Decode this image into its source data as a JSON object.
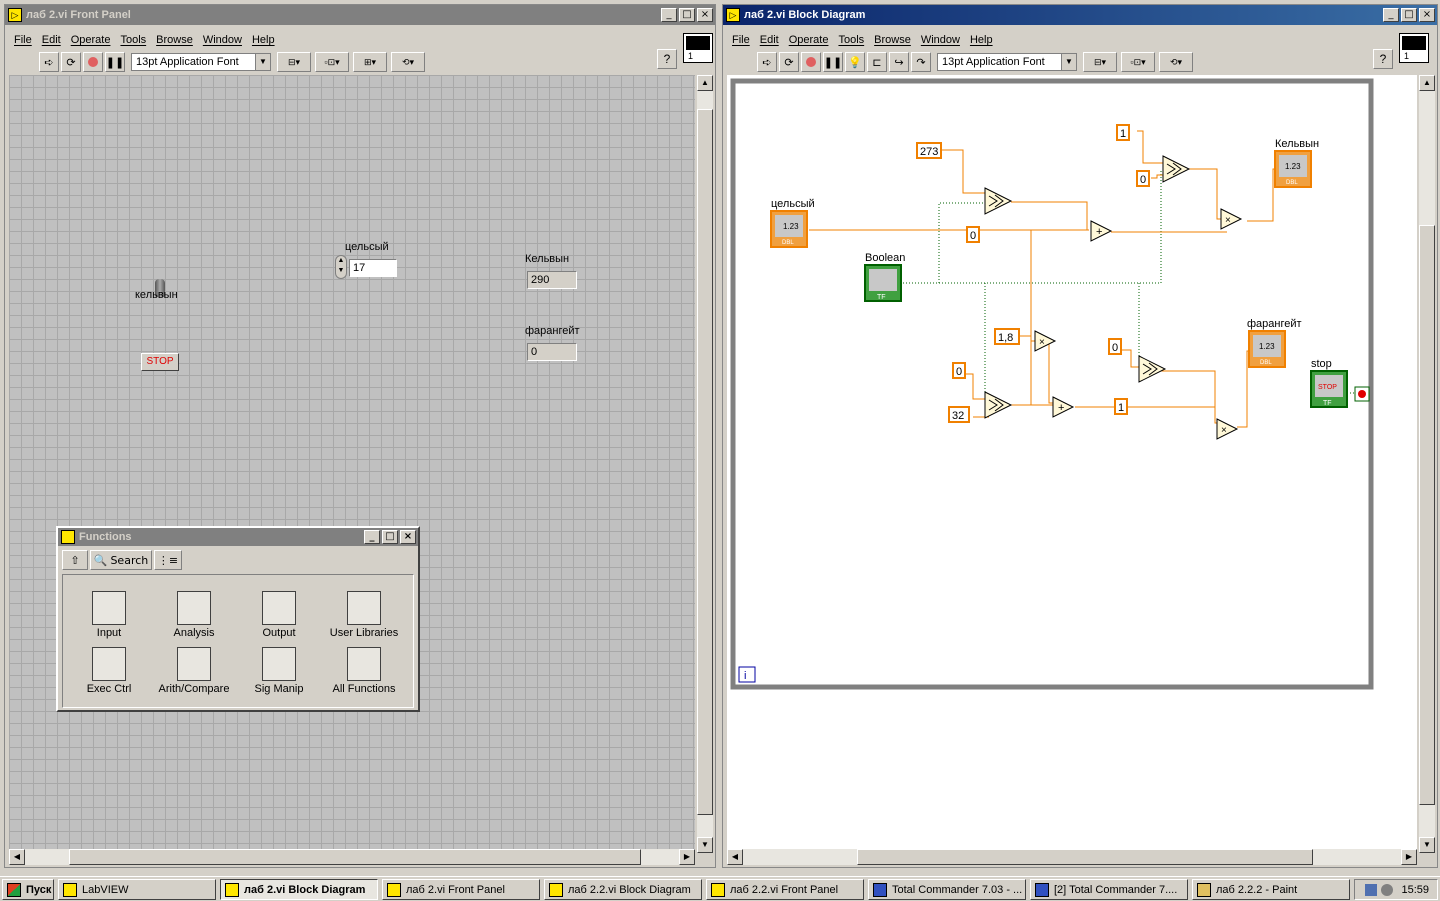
{
  "front_panel": {
    "title": "лаб 2.vi Front Panel",
    "menu": [
      "File",
      "Edit",
      "Operate",
      "Tools",
      "Browse",
      "Window",
      "Help"
    ],
    "font": "13pt Application Font",
    "vi_number": "1",
    "controls": {
      "toggle_label": "кельвын",
      "celsius_label": "цельсый",
      "celsius_value": "17",
      "kelvin_label": "Кельвын",
      "kelvin_value": "290",
      "fahrenheit_label": "фарангейт",
      "fahrenheit_value": "0",
      "stop_label": "STOP"
    }
  },
  "functions_palette": {
    "title": "Functions",
    "search_label": "Search",
    "items": [
      "Input",
      "Analysis",
      "Output",
      "User Libraries",
      "Exec Ctrl",
      "Arith/Compare",
      "Sig Manip",
      "All Functions"
    ]
  },
  "block_diagram": {
    "title": "лаб 2.vi Block Diagram",
    "menu": [
      "File",
      "Edit",
      "Operate",
      "Tools",
      "Browse",
      "Window",
      "Help"
    ],
    "font": "13pt Application Font",
    "vi_number": "1",
    "labels": {
      "celsius": "цельсый",
      "boolean": "Boolean",
      "kelvin": "Кельвын",
      "fahrenheit": "фарангейт",
      "stop": "stop",
      "dbl": "DBL",
      "tf": "TF",
      "num": "1.23",
      "stop_btn": "STOP",
      "loop_i": "i"
    },
    "constants": {
      "c273": "273",
      "c1_top": "1",
      "c0_top": "0",
      "c0_mid": "0",
      "c1_8": "1,8",
      "c0_right": "0",
      "c0_left": "0",
      "c32": "32",
      "c1_bottom": "1"
    }
  },
  "taskbar": {
    "start": "Пуск",
    "items": [
      "LabVIEW",
      "лаб 2.vi Block Diagram",
      "лаб 2.vi Front Panel",
      "лаб 2.2.vi Block Diagram",
      "лаб 2.2.vi Front Panel",
      "Total Commander 7.03 - ...",
      "[2] Total Commander 7....",
      "лаб 2.2.2 - Paint"
    ],
    "clock": "15:59"
  }
}
